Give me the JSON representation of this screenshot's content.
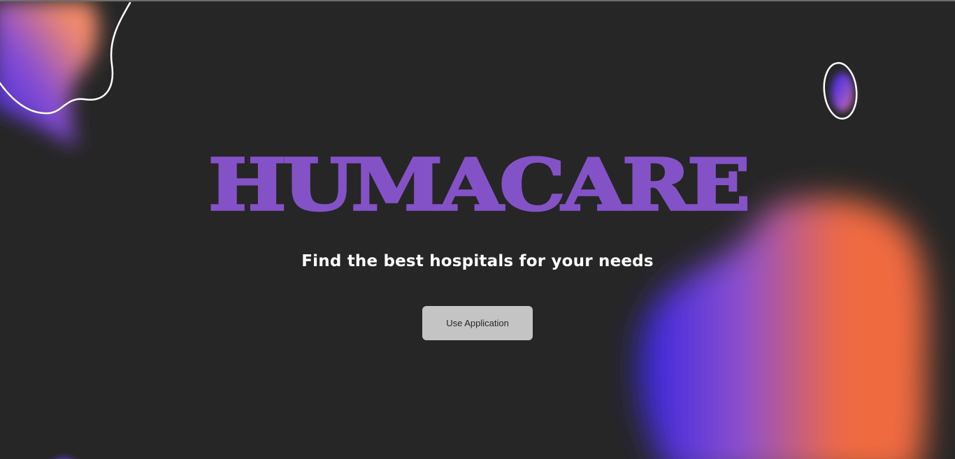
{
  "hero": {
    "title": "HUMACARE",
    "subtitle": "Find the best hospitals for your needs",
    "cta_label": "Use Application"
  },
  "colors": {
    "background": "#262626",
    "title": "#8452c7",
    "subtitle": "#ffffff",
    "button_bg": "#c4c4c4",
    "button_text": "#262626",
    "blob_blue": "#3324e0",
    "blob_purple": "#8a4fd0",
    "blob_orange": "#f06a40"
  }
}
